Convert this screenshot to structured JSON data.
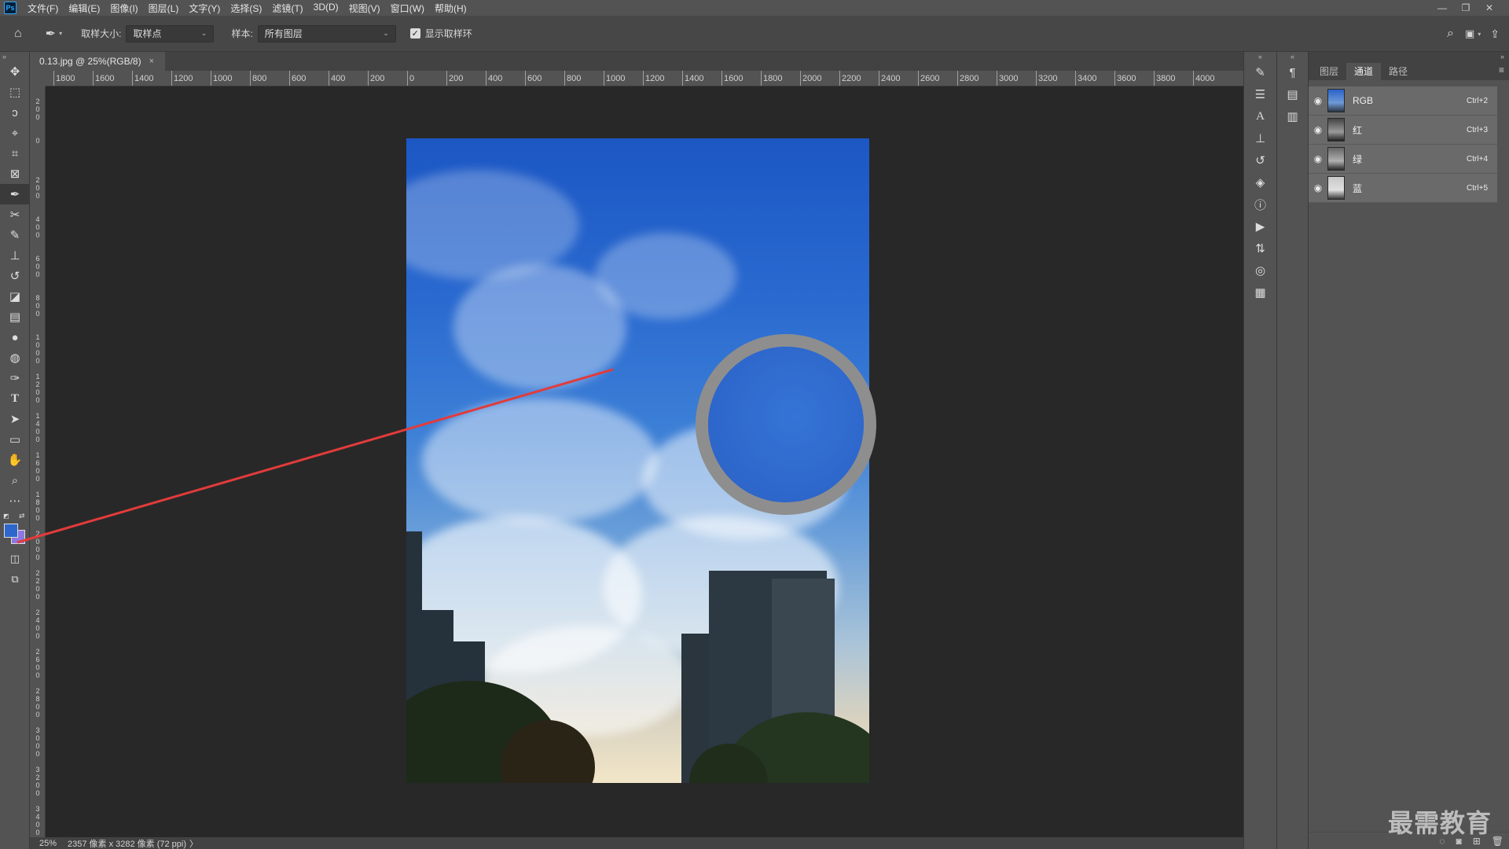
{
  "menubar": {
    "logo": "Ps",
    "items": [
      "文件(F)",
      "编辑(E)",
      "图像(I)",
      "图层(L)",
      "文字(Y)",
      "选择(S)",
      "滤镜(T)",
      "3D(D)",
      "视图(V)",
      "窗口(W)",
      "帮助(H)"
    ],
    "window_controls": [
      "—",
      "❐",
      "✕"
    ]
  },
  "optionsbar": {
    "sample_size_label": "取样大小:",
    "sample_size_value": "取样点",
    "sample_label": "样本:",
    "sample_value": "所有图层",
    "show_ring_label": "显示取样环",
    "show_ring_checked": true
  },
  "document": {
    "tab_title": "0.13.jpg @ 25%(RGB/8)",
    "tab_close": "×"
  },
  "ruler": {
    "top_labels": [
      "1800",
      "1600",
      "1400",
      "1200",
      "1000",
      "800",
      "600",
      "400",
      "200",
      "0",
      "200",
      "400",
      "600",
      "800",
      "1000",
      "1200",
      "1400",
      "1600",
      "1800",
      "2000",
      "2200",
      "2400",
      "2600",
      "2800",
      "3000",
      "3200",
      "3400",
      "3600",
      "3800",
      "4000"
    ],
    "left_labels": [
      "2\n0\n0",
      "0",
      "2\n0\n0",
      "4\n0\n0",
      "6\n0\n0",
      "8\n0\n0",
      "1\n0\n0\n0",
      "1\n2\n0\n0",
      "1\n4\n0\n0",
      "1\n6\n0\n0",
      "1\n8\n0\n0",
      "2\n0\n0\n0",
      "2\n2\n0\n0",
      "2\n4\n0\n0",
      "2\n6\n0\n0",
      "2\n8\n0\n0",
      "3\n0\n0\n0",
      "3\n2\n0\n0",
      "3\n4\n0\n0"
    ]
  },
  "statusbar": {
    "zoom": "25%",
    "doc_info": "2357 像素 x 3282 像素 (72 ppi)",
    "arrow": "〉"
  },
  "colors": {
    "foreground": "#2e66cc",
    "background": "#8c78e0",
    "annotation_line": "#e23b3b"
  },
  "channels_panel": {
    "tabs": [
      "图层",
      "通道",
      "路径"
    ],
    "active_tab": "通道",
    "channels": [
      {
        "name": "RGB",
        "shortcut": "Ctrl+2"
      },
      {
        "name": "红",
        "shortcut": "Ctrl+3"
      },
      {
        "name": "绿",
        "shortcut": "Ctrl+4"
      },
      {
        "name": "蓝",
        "shortcut": "Ctrl+5"
      }
    ]
  },
  "watermark": "最需教育"
}
